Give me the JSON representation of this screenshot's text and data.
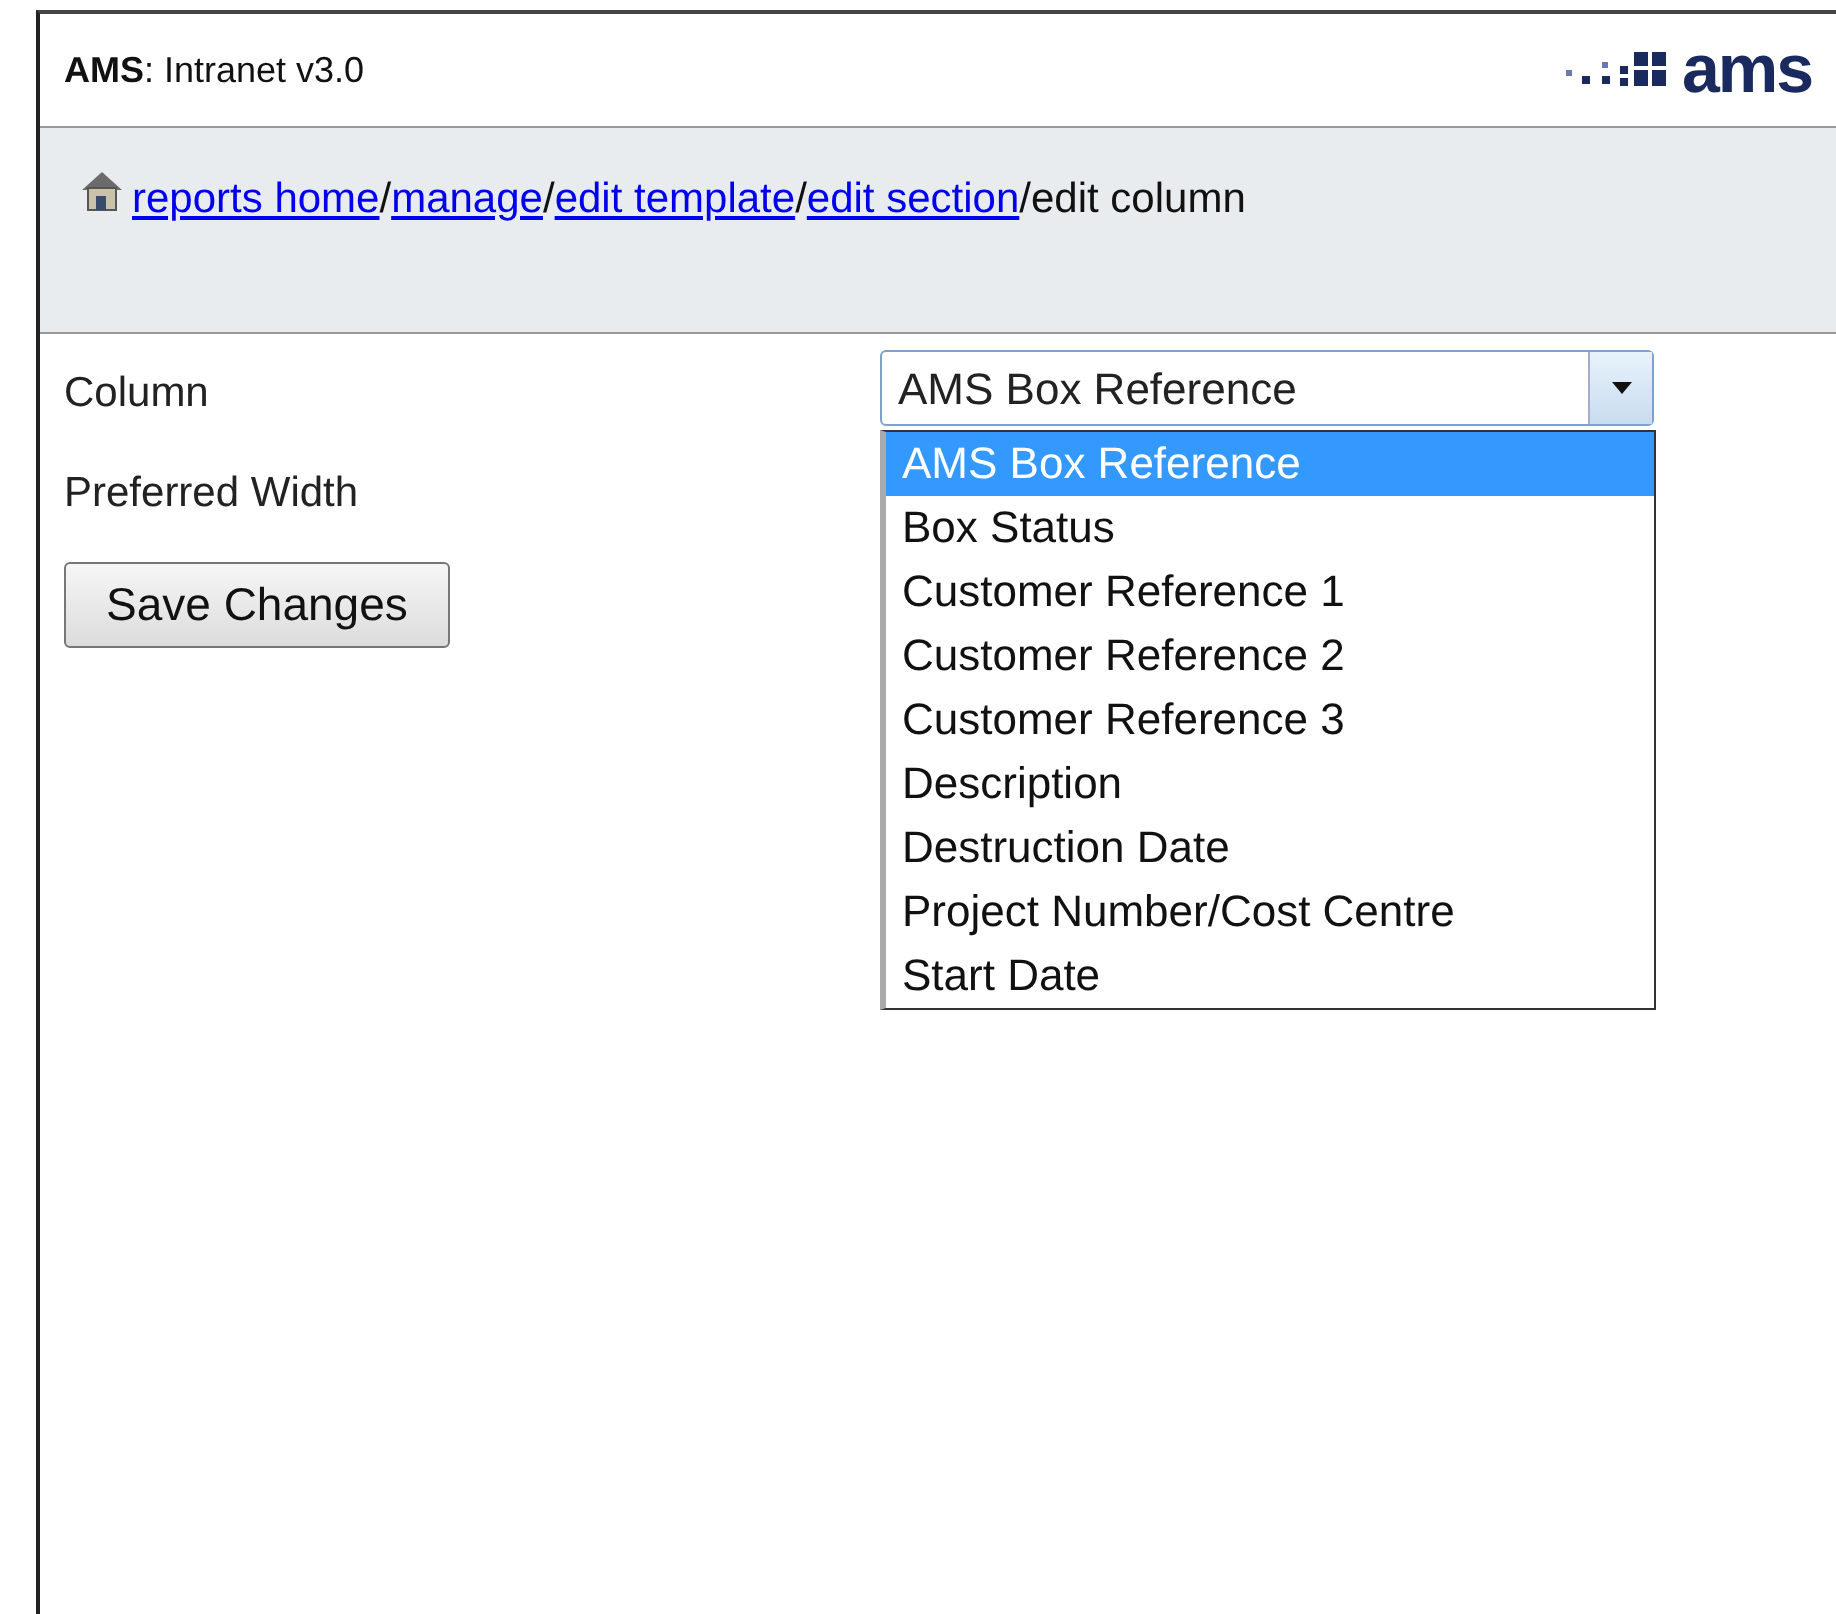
{
  "header": {
    "brand": "AMS",
    "title": ": Intranet v3.0",
    "logo_text": "ams"
  },
  "breadcrumb": {
    "links": [
      "reports home",
      "manage",
      "edit template",
      "edit section"
    ],
    "separator": "/",
    "current": "edit column"
  },
  "form": {
    "fields": [
      {
        "label": "Column",
        "select": {
          "value": "AMS Box Reference",
          "expanded": true,
          "options": [
            {
              "label": "AMS Box Reference",
              "selected": true
            },
            {
              "label": "Box Status",
              "selected": false
            },
            {
              "label": "Customer Reference 1",
              "selected": false
            },
            {
              "label": "Customer Reference 2",
              "selected": false
            },
            {
              "label": "Customer Reference 3",
              "selected": false
            },
            {
              "label": "Description",
              "selected": false
            },
            {
              "label": "Destruction Date",
              "selected": false
            },
            {
              "label": "Project Number/Cost Centre",
              "selected": false
            },
            {
              "label": "Start Date",
              "selected": false
            }
          ]
        }
      },
      {
        "label": "Preferred Width"
      }
    ],
    "button": "Save Changes"
  }
}
